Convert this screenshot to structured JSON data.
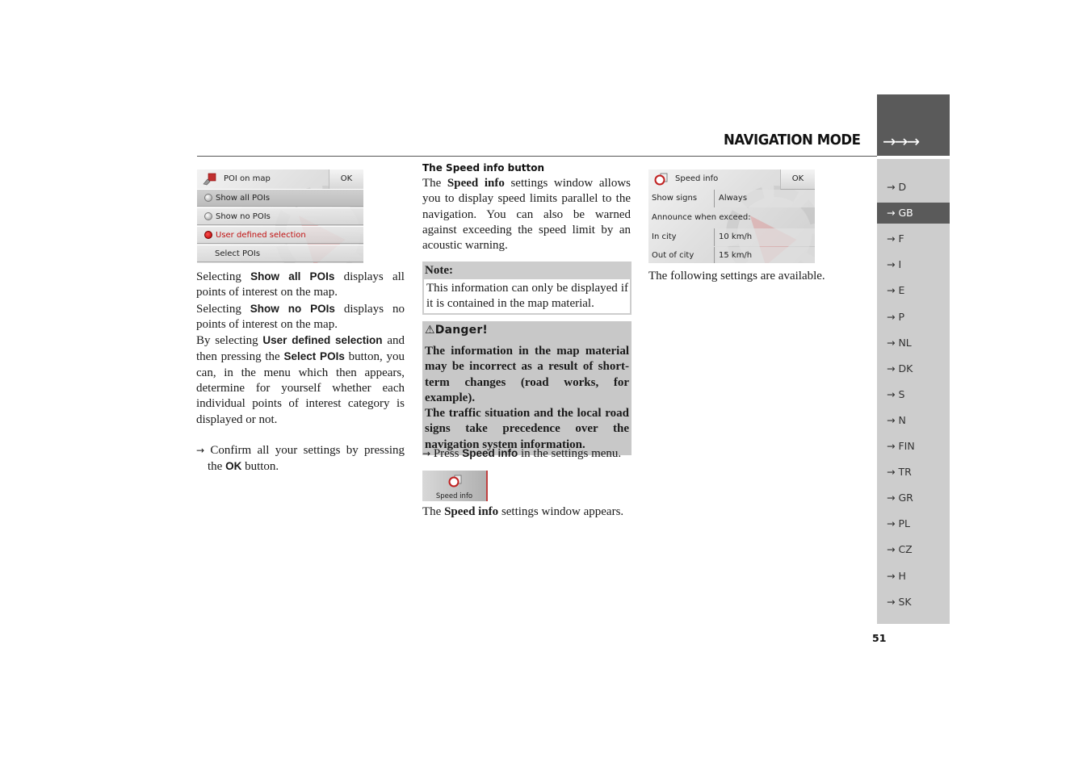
{
  "header": {
    "section_title": "NAVIGATION MODE",
    "tab_arrows": "→→→",
    "page_number": "51"
  },
  "languages": {
    "arrow": "→",
    "active": "GB",
    "items": [
      "D",
      "GB",
      "F",
      "I",
      "E",
      "P",
      "NL",
      "DK",
      "S",
      "N",
      "FIN",
      "TR",
      "GR",
      "PL",
      "CZ",
      "H",
      "SK"
    ]
  },
  "poi_screen": {
    "title": "POI on map",
    "ok": "OK",
    "options": [
      {
        "label": "Show all POIs",
        "selected": false
      },
      {
        "label": "Show no POIs",
        "selected": false
      },
      {
        "label": "User defined selection",
        "selected": true
      }
    ],
    "select_button": "Select POIs"
  },
  "column1": {
    "p1_pre": "Selecting ",
    "p1_bold": "Show all POIs",
    "p1_post": " displays all points of interest on the map.",
    "p2_pre": "Selecting ",
    "p2_bold": "Show no POIs",
    "p2_post": " displays no points of interest on the map.",
    "p3_pre": "By selecting ",
    "p3_bold1": "User defined selection",
    "p3_mid": " and then pressing the ",
    "p3_bold2": "Select POIs",
    "p3_post": " button, you can, in the menu which then appears, determine for yourself whether each individual points of interest category is displayed or not.",
    "step_arrow": "→",
    "step_pre": "Confirm all your settings by pressing the ",
    "step_bold": "OK",
    "step_post": " button."
  },
  "column2": {
    "heading": "The Speed info button",
    "intro_pre": "The ",
    "intro_bold": "Speed info",
    "intro_post": " settings window allows you to display speed limits parallel to the navigation. You can also be warned against exceeding the speed limit by an acoustic warning.",
    "note_title": "Note:",
    "note_body": "This information can only be displayed if it is contained in the map material.",
    "danger_icon": "⚠",
    "danger_title": "Danger!",
    "danger_p1": "The information in the map material may be incorrect as a result of short-term changes (road works, for example).",
    "danger_p2": "The traffic situation and the local road signs take precedence over the navigation system information.",
    "press_arrow": "→",
    "press_pre": "Press ",
    "press_bold": "Speed info",
    "press_post": " in the settings menu.",
    "button_label": "Speed info",
    "appears_pre": "The ",
    "appears_bold": "Speed info",
    "appears_post": " settings window appears."
  },
  "speed_screen": {
    "title": "Speed info",
    "ok": "OK",
    "show_signs_label": "Show signs",
    "show_signs_value": "Always",
    "announce_label": "Announce when exceed:",
    "in_city_label": "In city",
    "in_city_value": "10 km/h",
    "out_city_label": "Out of city",
    "out_city_value": "15 km/h"
  },
  "column3": {
    "text": "The following settings are available."
  }
}
